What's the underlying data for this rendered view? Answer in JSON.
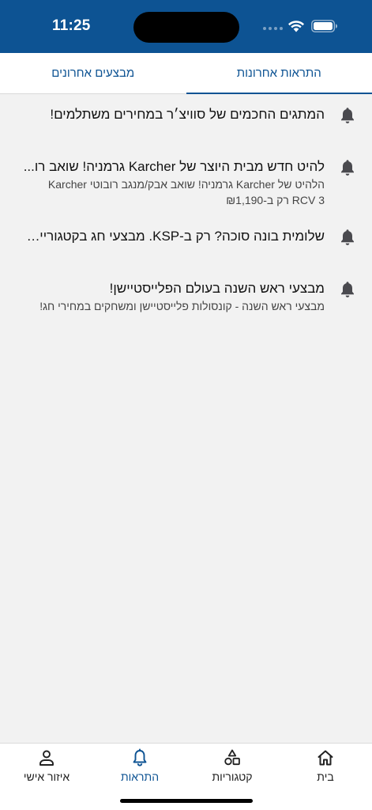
{
  "status_bar": {
    "time": "11:25"
  },
  "tabs": [
    {
      "label": "התראות אחרונות",
      "active": true
    },
    {
      "label": "מבצעים אחרונים",
      "active": false
    }
  ],
  "notifications": [
    {
      "title": "המתגים החכמים של סוויצ׳ר במחירים משתלמים!",
      "body": ""
    },
    {
      "title": "להיט חדש מבית היוצר של Karcher גרמניה! שואב רו...",
      "body": "הלהיט של Karcher גרמניה! שואב אבק/מנגב רובוטי Karcher RCV 3 רק ב-₪1,190"
    },
    {
      "title": "שלומית בונה סוכה? רק ב-KSP. מבצעי חג בקטגוריית...",
      "body": ""
    },
    {
      "title": "מבצעי ראש השנה בעולם הפלייסטיישן!",
      "body": "מבצעי ראש השנה - קונסולות פלייסטיישן ומשחקים במחירי חג!"
    }
  ],
  "tabbar": {
    "home": "בית",
    "categories": "קטגוריות",
    "notifications": "התראות",
    "account": "איזור אישי"
  },
  "colors": {
    "brand": "#0d5393",
    "background": "#f2f2f2"
  }
}
